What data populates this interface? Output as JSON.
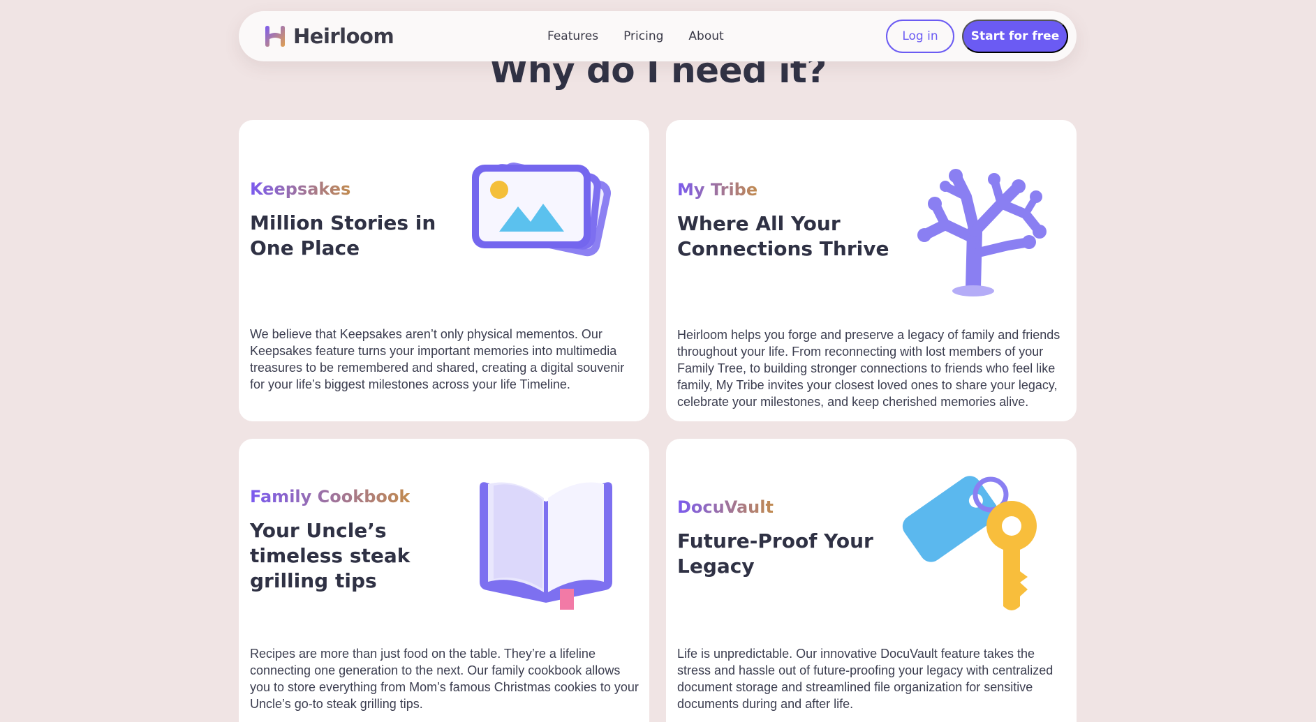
{
  "nav": {
    "brand": "Heirloom",
    "links": [
      "Features",
      "Pricing",
      "About"
    ],
    "login_label": "Log in",
    "start_label": "Start for free"
  },
  "section": {
    "title": "Why do I need it?"
  },
  "cards": [
    {
      "tag": "Keepsakes",
      "title": "Million Stories in One Place",
      "body": "We believe that Keepsakes aren’t only physical mementos. Our Keepsakes feature turns your important memories into multimedia treasures to be remembered and shared, creating a digital souvenir for your life’s biggest milestones across your life Timeline.",
      "icon": "photo-stack-icon"
    },
    {
      "tag": "My Tribe",
      "title": "Where All Your Connections Thrive",
      "body": "Heirloom helps you forge and preserve a legacy of family and friends throughout your life. From reconnecting with lost members of your Family Tree, to building stronger connections to friends who feel like family, My Tribe invites your closest loved ones to share your legacy, celebrate your milestones, and keep cherished memories alive.",
      "icon": "coral-tree-icon"
    },
    {
      "tag": "Family Cookbook",
      "title": "Your Uncle’s timeless steak grilling tips",
      "body": "Recipes are more than just food on the table. They’re a lifeline connecting one generation to the next. Our family cookbook allows you to store everything from Mom’s famous Christmas cookies to your Uncle’s go-to steak grilling tips.",
      "icon": "open-book-icon"
    },
    {
      "tag": "DocuVault",
      "title": "Future-Proof Your Legacy",
      "body": "Life is unpredictable. Our innovative DocuVault feature takes the stress and hassle out of future-proofing your legacy with centralized document storage and streamlined file organization for sensitive documents during and after life.",
      "icon": "key-tag-icon"
    }
  ],
  "colors": {
    "background": "#f0e4e4",
    "accent": "#6b5bf3",
    "card": "#ffffff",
    "heading": "#2f3144"
  }
}
